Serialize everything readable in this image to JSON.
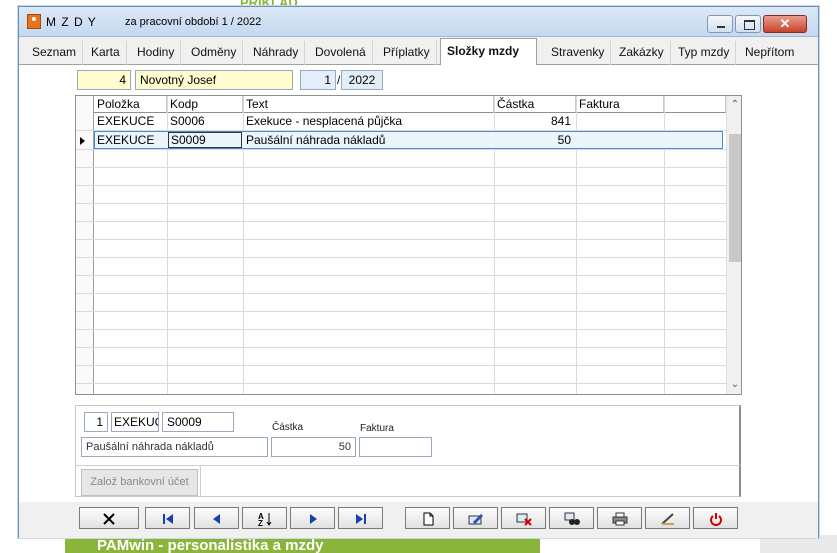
{
  "background": {
    "logo_fragment": "PRIKLAD",
    "banner_text": "PAMwin - personalistika a mzdy"
  },
  "window": {
    "title_main": "M Z D Y",
    "title_sub": "za pracovní období  1 / 2022",
    "close_symbol": "✕"
  },
  "tabs": [
    {
      "label": "Seznam"
    },
    {
      "label": "Karta"
    },
    {
      "label": "Hodiny"
    },
    {
      "label": "Odměny"
    },
    {
      "label": "Náhrady"
    },
    {
      "label": "Dovolená"
    },
    {
      "label": "Příplatky"
    },
    {
      "label": "Složky mzdy"
    },
    {
      "label": "Stravenky"
    },
    {
      "label": "Zakázky"
    },
    {
      "label": "Typ mzdy"
    },
    {
      "label": "Nepřítom"
    }
  ],
  "active_tab": "Složky mzdy",
  "header": {
    "employee_number": "4",
    "employee_name": "Novotný Josef",
    "period_month": "1",
    "period_separator": "/",
    "period_year": "2022"
  },
  "grid": {
    "columns": [
      "Položka",
      "Kodp",
      "Text",
      "Částka",
      "Faktura"
    ],
    "rows": [
      {
        "polozka": "EXEKUCE",
        "kodp": "S0006",
        "text": "Exekuce - nesplacená půjčka",
        "castka": "841",
        "faktura": ""
      },
      {
        "polozka": "EXEKUCE",
        "kodp": "S0009",
        "text": "Paušální náhrada nákladů",
        "castka": "50",
        "faktura": ""
      }
    ],
    "scroll_up": "⌃",
    "scroll_down": "⌄"
  },
  "detail": {
    "index": "1",
    "polozka": "EXEKUC",
    "kodp": "S0009",
    "text": "Paušální náhrada nákladů",
    "castka_label": "Částka",
    "castka_value": "50",
    "faktura_label": "Faktura",
    "faktura_value": "",
    "bank_button": "Založ bankovní účet"
  },
  "toolbar": {
    "buttons": [
      "cancel",
      "first",
      "previous",
      "sort",
      "next",
      "last",
      "new",
      "edit",
      "delete",
      "search",
      "print",
      "clear",
      "power"
    ]
  },
  "colors": {
    "accent_green": "#8ab43a",
    "field_yellow": "#fffccf",
    "field_blue": "#e3eefb",
    "selection_border": "#4a8cc7",
    "power_red": "#d00000"
  }
}
